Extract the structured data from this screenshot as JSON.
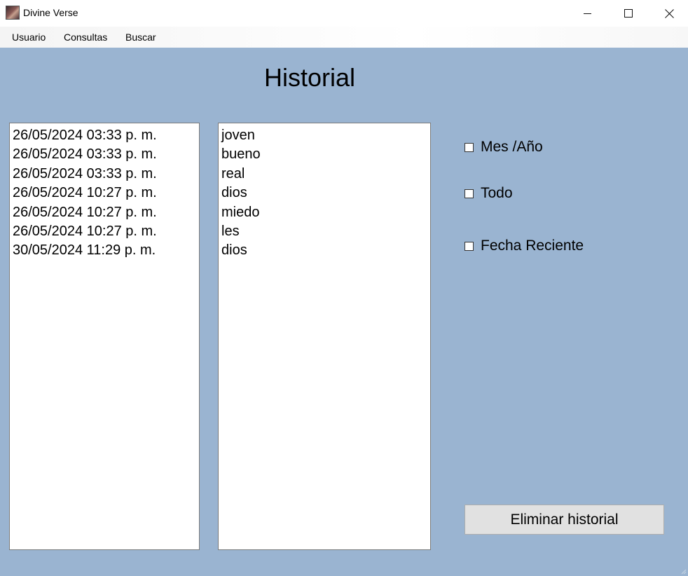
{
  "window": {
    "title": "Divine Verse",
    "icon": "app-icon"
  },
  "menu": {
    "items": [
      "Usuario",
      "Consultas",
      "Buscar"
    ]
  },
  "main": {
    "heading": "Historial",
    "dates": [
      "26/05/2024 03:33 p. m.",
      "26/05/2024 03:33 p. m.",
      "26/05/2024 03:33 p. m.",
      "26/05/2024 10:27 p. m.",
      "26/05/2024 10:27 p. m.",
      "26/05/2024 10:27 p. m.",
      "30/05/2024 11:29 p. m."
    ],
    "words": [
      "joven",
      "bueno",
      "real",
      "dios",
      "miedo",
      "les",
      "dios"
    ],
    "filters": {
      "month_year": {
        "label": "Mes /Año",
        "checked": false
      },
      "all": {
        "label": "Todo",
        "checked": false
      },
      "recent_date": {
        "label": "Fecha Reciente",
        "checked": false
      }
    },
    "delete_button": "Eliminar historial"
  },
  "colors": {
    "background": "#9ab4d1",
    "list_background": "#ffffff",
    "button": "#e1e1e1"
  }
}
